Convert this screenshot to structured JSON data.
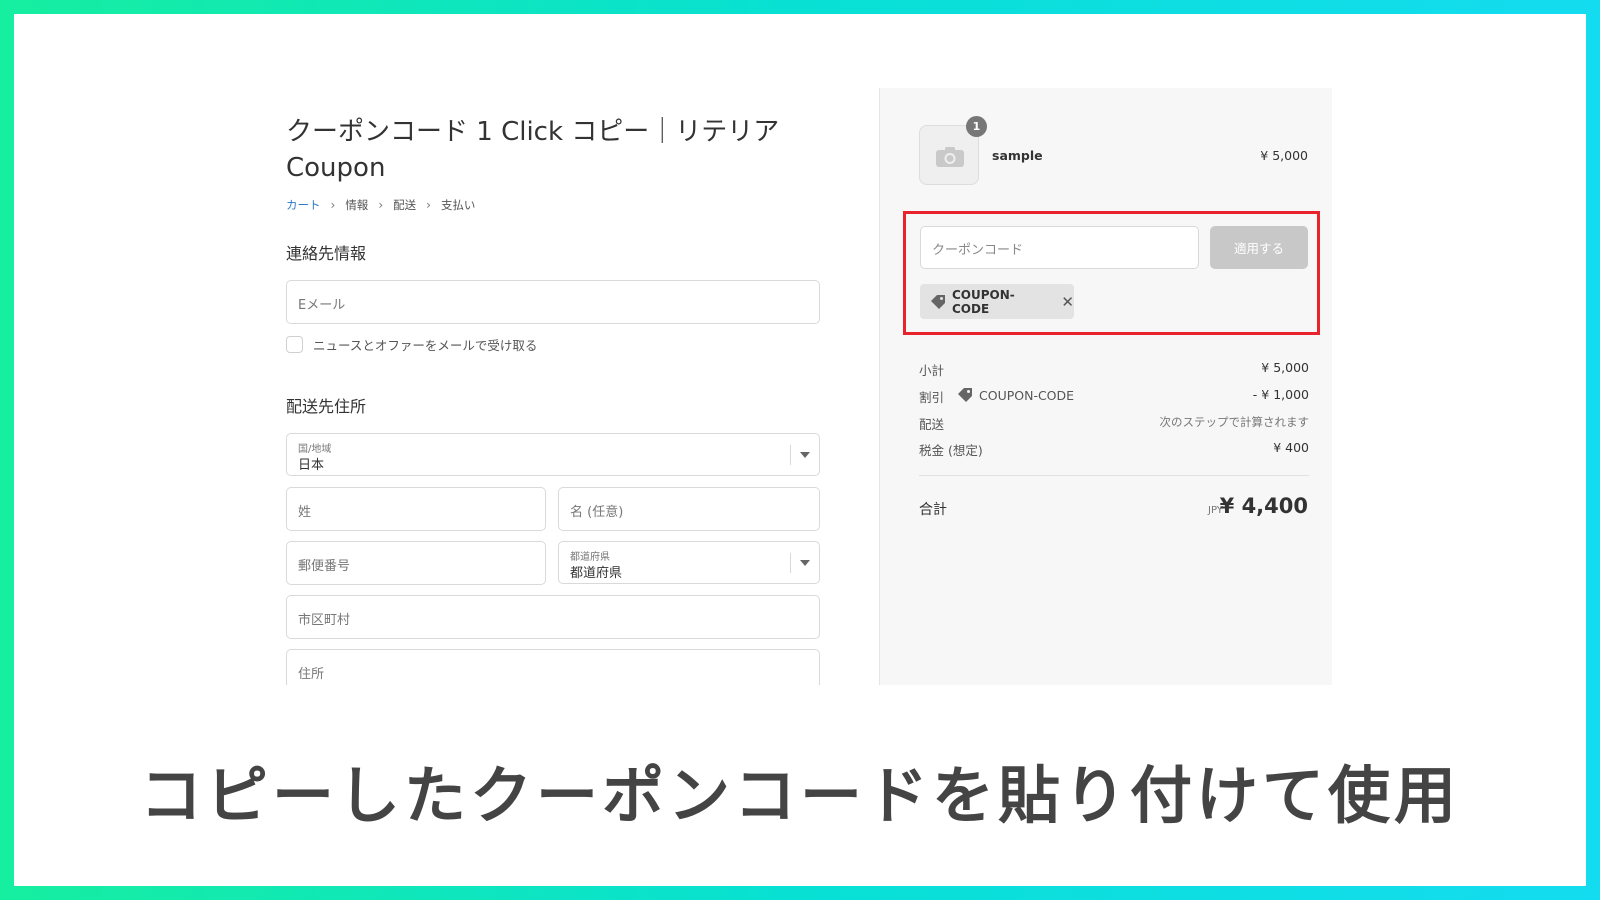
{
  "colors": {
    "frame_gradient_start": "#16eea0",
    "frame_gradient_end": "#14dcf0",
    "highlight_border": "#e8232b",
    "link": "#2a79c8",
    "apply_button_disabled": "#c8c8c8"
  },
  "header": {
    "shop_title": "クーポンコード 1 Click コピー｜リテリア Coupon"
  },
  "breadcrumb": {
    "items": [
      "カート",
      "情報",
      "配送",
      "支払い"
    ]
  },
  "contact": {
    "heading": "連絡先情報",
    "email_placeholder": "Eメール",
    "newsletter_label": "ニュースとオファーをメールで受け取る"
  },
  "shipping": {
    "heading": "配送先住所",
    "country_label": "国/地域",
    "country_value": "日本",
    "last_name_placeholder": "姓",
    "first_name_placeholder": "名 (任意)",
    "postal_placeholder": "郵便番号",
    "prefecture_label": "都道府県",
    "prefecture_value": "都道府県",
    "city_placeholder": "市区町村",
    "address_placeholder": "住所"
  },
  "order": {
    "product": {
      "name": "sample",
      "price": "¥ 5,000",
      "quantity": "1",
      "thumbnail_icon": "camera-icon"
    },
    "coupon": {
      "input_placeholder": "クーポンコード",
      "apply_label": "適用する",
      "applied_code": "COUPON-CODE",
      "tag_icon": "tag-icon",
      "remove_icon": "close-icon",
      "remove_symbol": "✕"
    },
    "summary": {
      "subtotal_label": "小計",
      "subtotal_value": "¥ 5,000",
      "discount_label": "割引",
      "discount_code": "COUPON-CODE",
      "discount_value": "- ¥ 1,000",
      "shipping_label": "配送",
      "shipping_value": "次のステップで計算されます",
      "tax_label": "税金 (想定)",
      "tax_value": "¥ 400",
      "total_label": "合計",
      "total_currency": "JPY",
      "total_value": "¥ 4,400"
    }
  },
  "caption": {
    "text": "コピーしたクーポンコードを貼り付けて使用"
  }
}
